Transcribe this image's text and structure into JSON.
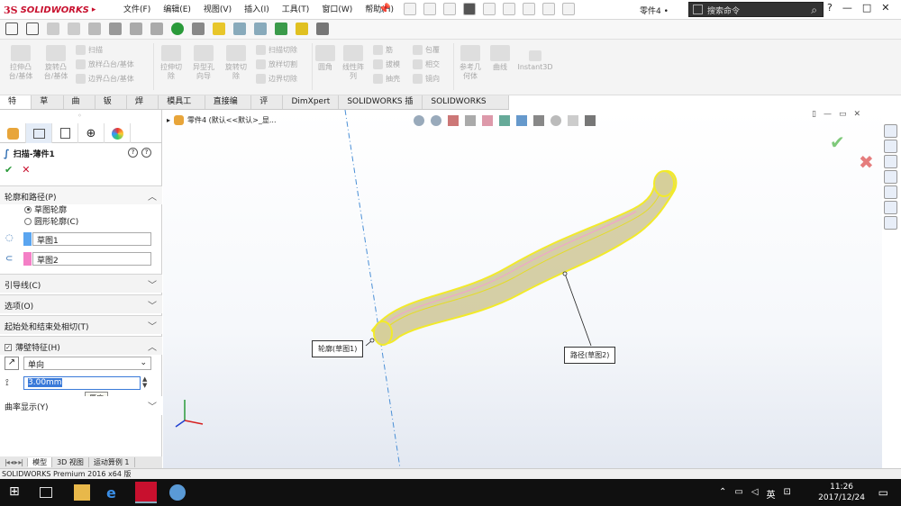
{
  "app": {
    "logo_ds": "3S",
    "logo_text": "SOLIDWORKS",
    "doc_name": "零件4",
    "doc_name_suffix": " •",
    "search_placeholder": "搜索命令",
    "help": "?",
    "minimize": "—",
    "restore": "□",
    "close": "✕"
  },
  "menu": [
    "文件(F)",
    "编辑(E)",
    "视图(V)",
    "插入(I)",
    "工具(T)",
    "窗口(W)",
    "帮助(H)"
  ],
  "ribbon": {
    "big_buttons": [
      {
        "label": "拉伸凸\n台/基体"
      },
      {
        "label": "旋转凸\n台/基体"
      },
      {
        "label": "拉伸切\n除"
      },
      {
        "label": "异型孔\n向导"
      },
      {
        "label": "旋转切\n除"
      },
      {
        "label": "圆角"
      },
      {
        "label": "线性阵\n列"
      },
      {
        "label": "参考几\n何体"
      },
      {
        "label": "曲线"
      },
      {
        "label": "Instant3D"
      }
    ],
    "small_col1": [
      "扫描",
      "放样凸台/基体",
      "边界凸台/基体"
    ],
    "small_col2": [
      "扫描切除",
      "放样切割",
      "边界切除"
    ],
    "small_col3": [
      "筋",
      "拔模",
      "抽壳"
    ],
    "small_col4": [
      "包覆",
      "相交",
      "镜向"
    ]
  },
  "tabs": [
    "特征",
    "草图",
    "曲面",
    "钣金",
    "焊件",
    "模具工具",
    "直接编辑",
    "评估",
    "DimXpert",
    "SOLIDWORKS 插件",
    "SOLIDWORKS MBD"
  ],
  "active_tab": "特征",
  "panel": {
    "title": "扫描-薄件1",
    "ok_icon": "✔",
    "cancel_icon": "✕",
    "section_profile": "轮廓和路径(P)",
    "radio_sketch_profile": "草图轮廓",
    "radio_circle_profile": "圆形轮廓(C)",
    "profile_value": "草图1",
    "path_value": "草图2",
    "section_guides": "引导线(C)",
    "section_options": "选项(O)",
    "section_tangency": "起始处和结束处相切(T)",
    "section_thin": "薄壁特征(H)",
    "thin_type": "单向",
    "thickness_value": "3.00mm",
    "thickness_tooltip": "厚度",
    "section_curvature": "曲率显示(Y)"
  },
  "bottom_tabs": [
    "模型",
    "3D 视图",
    "运动算例 1"
  ],
  "status_text": "SOLIDWORKS Premium 2016 x64 版",
  "viewport": {
    "tree_item": "零件4 (默认<<默认>_显...",
    "callout_profile": "轮廓(草图1)",
    "callout_path": "路径(草图2)",
    "accept_color": "#7fc97a",
    "cancel_color": "#e57d7d",
    "edge_color": "#f2ea2a",
    "body_color": "#c9c08a"
  },
  "taskbar": {
    "time": "11:26",
    "date": "2017/12/24",
    "ime": "英",
    "ime_view": "英"
  }
}
